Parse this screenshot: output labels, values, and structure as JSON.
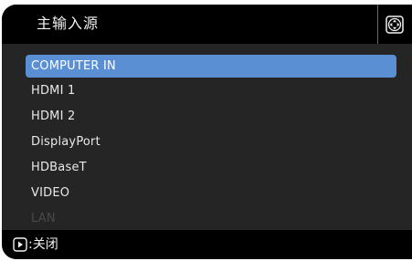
{
  "header": {
    "title": "主输入源",
    "nav_icon": "four-way-arrows-icon"
  },
  "menu": {
    "items": [
      {
        "label": "COMPUTER IN",
        "state": "selected"
      },
      {
        "label": "HDMI 1",
        "state": "normal"
      },
      {
        "label": "HDMI 2",
        "state": "normal"
      },
      {
        "label": "DisplayPort",
        "state": "normal"
      },
      {
        "label": "HDBaseT",
        "state": "normal"
      },
      {
        "label": "VIDEO",
        "state": "normal"
      },
      {
        "label": "LAN",
        "state": "disabled"
      }
    ]
  },
  "footer": {
    "icon": "right-arrow-button-icon",
    "label": ":关闭"
  },
  "colors": {
    "highlight": "#5b8fd4",
    "panel": "#252525",
    "bar": "#000000",
    "disabled_text": "#4a4a4a"
  }
}
